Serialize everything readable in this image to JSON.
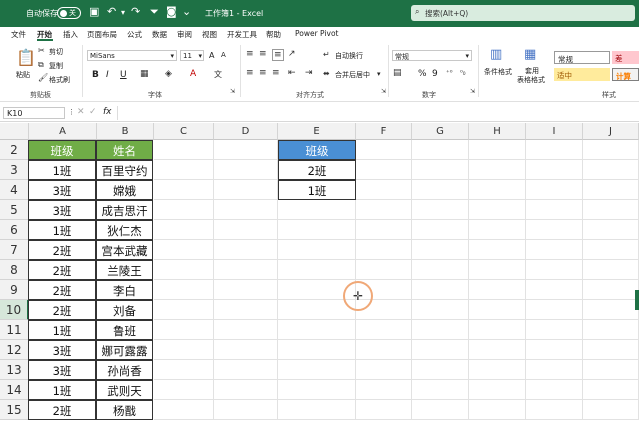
{
  "titlebar": {
    "autosave_label": "自动保存",
    "toggle_state": "关",
    "doc_title": "工作簿1 - Excel",
    "search_placeholder": "搜索(Alt+Q)"
  },
  "menu": {
    "tabs": [
      "文件",
      "开始",
      "插入",
      "页面布局",
      "公式",
      "数据",
      "审阅",
      "视图",
      "开发工具",
      "帮助",
      "Power Pivot"
    ],
    "active_tab": "开始"
  },
  "ribbon": {
    "clipboard": {
      "paste": "粘贴",
      "cut": "剪切",
      "copy": "复制",
      "format_painter": "格式刷",
      "group": "剪贴板"
    },
    "font": {
      "name": "MiSans",
      "size": "11",
      "group": "字体",
      "bold": "B",
      "italic": "I",
      "underline": "U"
    },
    "alignment": {
      "wrap": "自动换行",
      "merge": "合并后居中",
      "group": "对齐方式"
    },
    "number": {
      "format": "常规",
      "group": "数字",
      "percent": "%",
      "comma": "9"
    },
    "styles": {
      "conditional": "条件格式",
      "table_format_1": "套用",
      "table_format_2": "表格格式",
      "normal": "常规",
      "bad": "差",
      "neutral": "适中",
      "calc": "计算",
      "group": "样式"
    }
  },
  "formula_bar": {
    "name_box": "K10",
    "fx": "fx",
    "value": ""
  },
  "columns": [
    "A",
    "B",
    "C",
    "D",
    "E",
    "F",
    "G",
    "H",
    "I",
    "J"
  ],
  "rows": [
    "2",
    "3",
    "4",
    "5",
    "6",
    "7",
    "8",
    "9",
    "10",
    "11",
    "12",
    "13",
    "14",
    "15"
  ],
  "table_ab": {
    "header": [
      "班级",
      "姓名"
    ],
    "data": [
      [
        "1班",
        "百里守约"
      ],
      [
        "3班",
        "嫦娥"
      ],
      [
        "3班",
        "成吉思汗"
      ],
      [
        "1班",
        "狄仁杰"
      ],
      [
        "2班",
        "宫本武藏"
      ],
      [
        "2班",
        "兰陵王"
      ],
      [
        "2班",
        "李白"
      ],
      [
        "2班",
        "刘备"
      ],
      [
        "1班",
        "鲁班"
      ],
      [
        "3班",
        "娜可露露"
      ],
      [
        "3班",
        "孙尚香"
      ],
      [
        "1班",
        "武则天"
      ],
      [
        "2班",
        "杨戬"
      ]
    ]
  },
  "table_e": {
    "header": "班级",
    "values": [
      "2班",
      "1班"
    ]
  },
  "colors": {
    "excel_green": "#1e7145",
    "header_green": "#70ad47",
    "header_blue": "#4a8fd4"
  }
}
